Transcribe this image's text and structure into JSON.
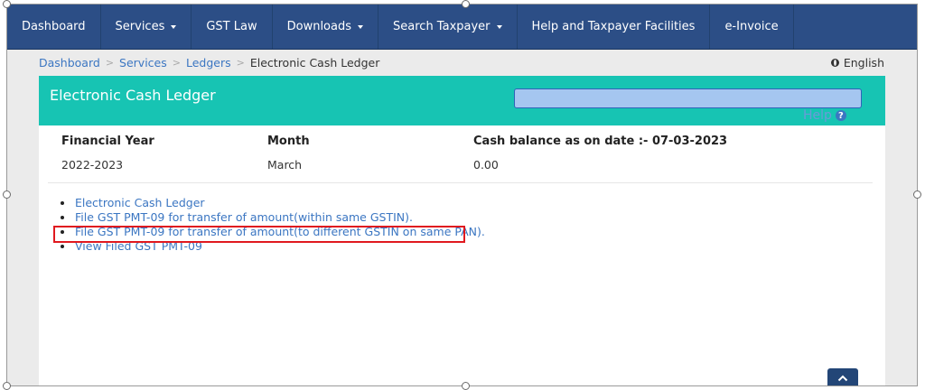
{
  "nav": {
    "items": [
      {
        "label": "Dashboard",
        "caret": false
      },
      {
        "label": "Services",
        "caret": true
      },
      {
        "label": "GST Law",
        "caret": false
      },
      {
        "label": "Downloads",
        "caret": true
      },
      {
        "label": "Search Taxpayer",
        "caret": true
      },
      {
        "label": "Help and Taxpayer Facilities",
        "caret": false
      },
      {
        "label": "e-Invoice",
        "caret": false
      }
    ]
  },
  "breadcrumb": {
    "items": [
      "Dashboard",
      "Services",
      "Ledgers"
    ],
    "current": "Electronic Cash Ledger",
    "separator": ">"
  },
  "language": {
    "label": "English",
    "icon": "globe-icon"
  },
  "panel": {
    "title": "Electronic Cash Ledger",
    "help_label": "Help",
    "help_icon": "help-circle-icon"
  },
  "info": {
    "financial_year_label": "Financial Year",
    "financial_year_value": "2022-2023",
    "month_label": "Month",
    "month_value": "March",
    "cash_balance_label": "Cash balance as on date :- 07-03-2023",
    "cash_balance_value": "0.00"
  },
  "links": [
    "Electronic Cash Ledger",
    "File GST PMT-09 for transfer of amount(within same GSTIN).",
    "File GST PMT-09 for transfer of amount(to different GSTIN on same PAN).",
    "View Filed GST PMT-09"
  ],
  "colors": {
    "navbar": "#2c4e86",
    "panel_header": "#17c4b3",
    "link": "#3b76c2",
    "highlight": "#e0191f"
  }
}
